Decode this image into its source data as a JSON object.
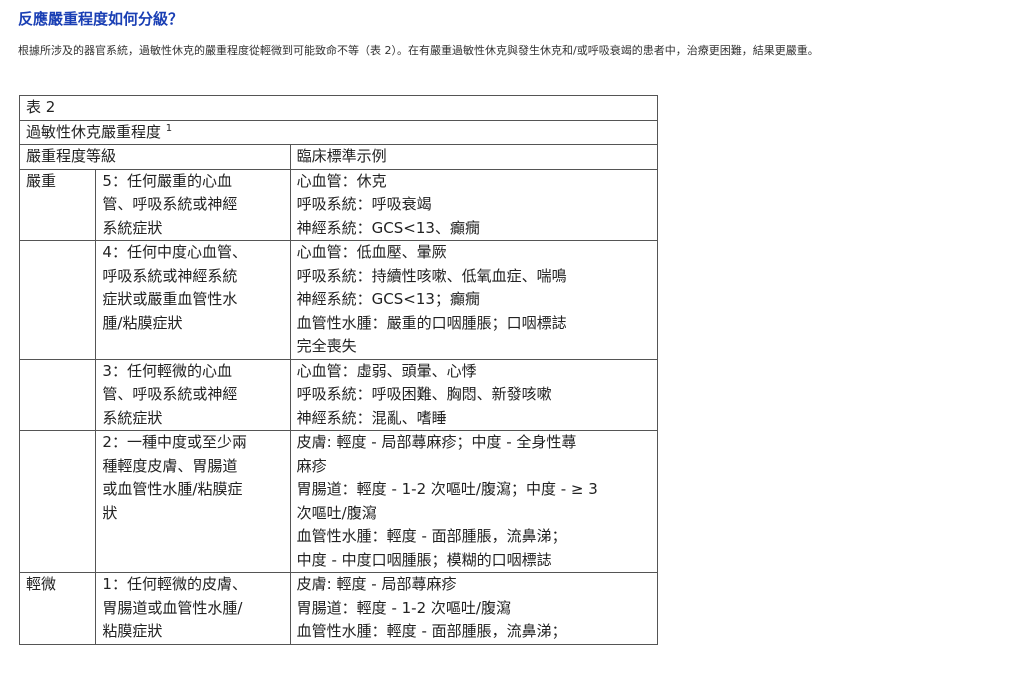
{
  "page": {
    "heading": "反應嚴重程度如何分級？",
    "intro": "根據所涉及的器官系統，過敏性休克的嚴重程度從輕微到可能致命不等（表 2）。在有嚴重過敏性休克與發生休克和/或呼吸衰竭的患者中，治療更困難，結果更嚴重。"
  },
  "table": {
    "caption": "表 2",
    "title": "過敏性休克嚴重程度",
    "title_sup": "1",
    "col_grade": "嚴重程度等級",
    "col_criteria": "臨床標準示例",
    "rows": [
      {
        "group": "嚴重",
        "grade": [
          "5：任何嚴重的心血",
          "管、呼吸系統或神經",
          "系統症狀"
        ],
        "criteria": [
          "心血管：休克",
          "呼吸系統：呼吸衰竭",
          "神經系統：GCS<13、癲癇"
        ]
      },
      {
        "group": "",
        "grade": [
          "4：任何中度心血管、",
          "呼吸系統或神經系統",
          "症狀或嚴重血管性水",
          "腫/粘膜症狀"
        ],
        "criteria": [
          "心血管：低血壓、暈厥",
          "呼吸系統：持續性咳嗽、低氧血症、喘鳴",
          "神經系統：GCS<13；癲癇",
          "血管性水腫：嚴重的口咽腫脹；口咽標誌",
          "完全喪失"
        ]
      },
      {
        "group": "",
        "grade": [
          "3：任何輕微的心血",
          "管、呼吸系統或神經",
          "系統症狀"
        ],
        "criteria": [
          "心血管：虛弱、頭暈、心悸",
          "呼吸系統：呼吸困難、胸悶、新發咳嗽",
          "神經系統：混亂、嗜睡"
        ]
      },
      {
        "group": "",
        "grade": [
          "2：一種中度或至少兩",
          "種輕度皮膚、胃腸道",
          "或血管性水腫/粘膜症",
          "狀"
        ],
        "criteria": [
          "皮膚: 輕度 - 局部蕁麻疹；中度 - 全身性蕁",
          "麻疹",
          "胃腸道：輕度 - 1-2 次嘔吐/腹瀉；中度 - ≥ 3",
          "次嘔吐/腹瀉",
          "血管性水腫：輕度 - 面部腫脹，流鼻涕；",
          "中度 - 中度口咽腫脹；模糊的口咽標誌"
        ]
      },
      {
        "group": "輕微",
        "grade": [
          "1：任何輕微的皮膚、",
          "胃腸道或血管性水腫/",
          "粘膜症狀"
        ],
        "criteria": [
          "皮膚: 輕度 - 局部蕁麻疹",
          "胃腸道：輕度 - 1-2 次嘔吐/腹瀉",
          "血管性水腫：輕度 - 面部腫脹，流鼻涕；"
        ]
      }
    ]
  }
}
